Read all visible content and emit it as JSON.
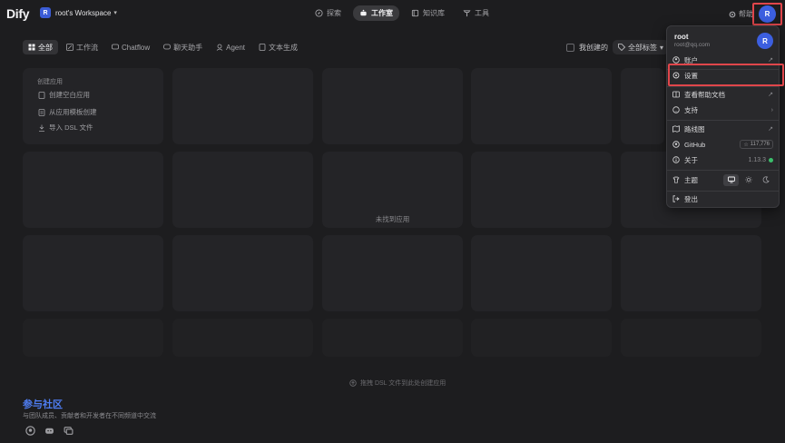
{
  "app": {
    "logo": "Dify",
    "workspace_initial": "R",
    "workspace_name": "root's Workspace"
  },
  "nav": [
    {
      "label": "探索",
      "active": false
    },
    {
      "label": "工作室",
      "active": true
    },
    {
      "label": "知识库",
      "active": false
    },
    {
      "label": "工具",
      "active": false
    }
  ],
  "header": {
    "help_label": "帮助",
    "avatar_initial": "R"
  },
  "filters": [
    "全部",
    "工作流",
    "Chatflow",
    "聊天助手",
    "Agent",
    "文本生成"
  ],
  "toolbar": {
    "mine_label": "我创建的",
    "tags_label": "全部标签"
  },
  "create": {
    "title": "创建应用",
    "items": [
      "创建空白应用",
      "从应用模板创建",
      "导入 DSL 文件"
    ]
  },
  "main": {
    "empty_text": "未找到应用",
    "drop_hint": "拖拽 DSL 文件到此处创建应用"
  },
  "community": {
    "title": "参与社区",
    "desc": "与团队成员、贡献者和开发者在不同频道中交流"
  },
  "menu": {
    "name": "root",
    "email": "root@qq.com",
    "avatar_initial": "R",
    "account": "账户",
    "settings": "设置",
    "help_docs": "查看帮助文档",
    "support": "支持",
    "roadmap": "路线图",
    "github": "GitHub",
    "github_stars": "117,776",
    "about": "关于",
    "version": "1.13.3",
    "theme": "主题",
    "logout": "登出"
  },
  "colors": {
    "accent": "#3c5fe0",
    "highlight": "#e0464b",
    "community": "#4f7ef4",
    "status_ok": "#3bbf6b"
  }
}
